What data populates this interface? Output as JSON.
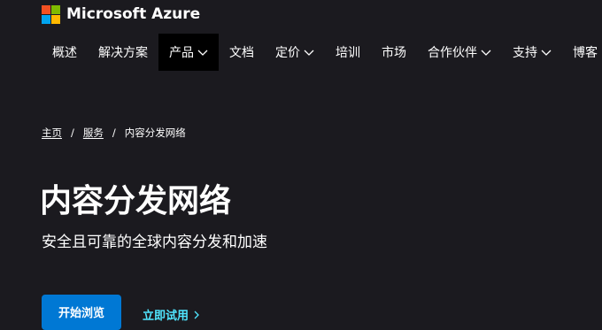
{
  "brand": {
    "name": "Microsoft Azure",
    "colors": {
      "red": "#f25022",
      "green": "#7fba00",
      "blue": "#00a4ef",
      "yellow": "#ffb900"
    }
  },
  "nav": {
    "items": [
      {
        "label": "概述",
        "has_dropdown": false
      },
      {
        "label": "解决方案",
        "has_dropdown": false
      },
      {
        "label": "产品",
        "has_dropdown": true,
        "active": true
      },
      {
        "label": "文档",
        "has_dropdown": false
      },
      {
        "label": "定价",
        "has_dropdown": true
      },
      {
        "label": "培训",
        "has_dropdown": false
      },
      {
        "label": "市场",
        "has_dropdown": false
      },
      {
        "label": "合作伙伴",
        "has_dropdown": true
      },
      {
        "label": "支持",
        "has_dropdown": true
      },
      {
        "label": "博客",
        "has_dropdown": false
      }
    ]
  },
  "breadcrumb": {
    "home": "主页",
    "separator": "/",
    "services": "服务",
    "current": "内容分发网络"
  },
  "hero": {
    "title": "内容分发网络",
    "subtitle": "安全且可靠的全球内容分发和加速",
    "primary_button": "开始浏览",
    "secondary_link": "立即试用"
  },
  "colors": {
    "background": "#1b1a1f",
    "primary_button": "#0078d4",
    "link": "#50e6ff",
    "active_nav": "#000000"
  }
}
